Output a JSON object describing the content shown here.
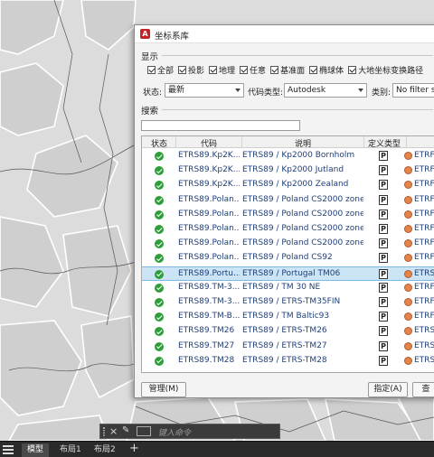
{
  "dialog": {
    "title": "坐标系库",
    "display_label": "显示",
    "filters": [
      "全部",
      "投影",
      "地理",
      "任意",
      "基准面",
      "椭球体",
      "大地坐标变换路径"
    ],
    "status_label": "状态:",
    "status_value": "最新",
    "code_type_label": "代码类型:",
    "code_type_value": "Autodesk",
    "category_label": "类别:",
    "category_value": "No filter se",
    "search_label": "搜索",
    "search_value": "",
    "columns": [
      "状态",
      "代码",
      "说明",
      "定义类型"
    ],
    "rows": [
      {
        "code": "ETRS89.Kp2K...",
        "desc": "ETRS89 / Kp2000 Bornholm",
        "def": "P",
        "extra": "ETRF8"
      },
      {
        "code": "ETRS89.Kp2K...",
        "desc": "ETRS89 / Kp2000 Jutland",
        "def": "P",
        "extra": "ETRF8"
      },
      {
        "code": "ETRS89.Kp2K...",
        "desc": "ETRS89 / Kp2000 Zealand",
        "def": "P",
        "extra": "ETRF8"
      },
      {
        "code": "ETRS89.Polan...",
        "desc": "ETRS89 / Poland CS2000 zone 5",
        "def": "P",
        "extra": "ETRF8"
      },
      {
        "code": "ETRS89.Polan...",
        "desc": "ETRS89 / Poland CS2000 zone 6",
        "def": "P",
        "extra": "ETRF8"
      },
      {
        "code": "ETRS89.Polan...",
        "desc": "ETRS89 / Poland CS2000 zone 7",
        "def": "P",
        "extra": "ETRF8"
      },
      {
        "code": "ETRS89.Polan...",
        "desc": "ETRS89 / Poland CS2000 zone 8",
        "def": "P",
        "extra": "ETRF8"
      },
      {
        "code": "ETRS89.Polan...",
        "desc": "ETRS89 / Poland CS92",
        "def": "P",
        "extra": "ETRF8"
      },
      {
        "code": "ETRS89.Portu...",
        "desc": "ETRS89 / Portugal TM06",
        "def": "P",
        "extra": "ETRS8"
      },
      {
        "code": "ETRS89.TM-3...",
        "desc": "ETRS89 / TM 30 NE",
        "def": "P",
        "extra": "ETRF8"
      },
      {
        "code": "ETRS89.TM-3...",
        "desc": "ETRS89 / ETRS-TM35FIN",
        "def": "P",
        "extra": "ETRF8"
      },
      {
        "code": "ETRS89.TM-B...",
        "desc": "ETRS89 / TM Baltic93",
        "def": "P",
        "extra": "ETRF8"
      },
      {
        "code": "ETRS89.TM26",
        "desc": "ETRS89 / ETRS-TM26",
        "def": "P",
        "extra": "ETRS8"
      },
      {
        "code": "ETRS89.TM27",
        "desc": "ETRS89 / ETRS-TM27",
        "def": "P",
        "extra": "ETRS8"
      },
      {
        "code": "ETRS89.TM28",
        "desc": "ETRS89 / ETRS-TM28",
        "def": "P",
        "extra": "ETRS8"
      }
    ],
    "selected_row": 8,
    "manage_button": "管理(M)",
    "assign_button": "指定(A)",
    "cancel_button": "查"
  },
  "command_line": {
    "placeholder": "键入命令"
  },
  "status_bar": {
    "tabs": [
      "模型",
      "布局1",
      "布局2"
    ],
    "add_label": "+"
  },
  "colors": {
    "status_ok": "#2e9e3a",
    "selected_row": "#cce5f6",
    "link_text": "#1f3f78"
  },
  "icons": [
    "app-icon",
    "check-icon",
    "status-ok-icon",
    "projection-icon",
    "globe-icon",
    "wrench-icon",
    "close-icon",
    "menu-icon",
    "plus-icon"
  ]
}
